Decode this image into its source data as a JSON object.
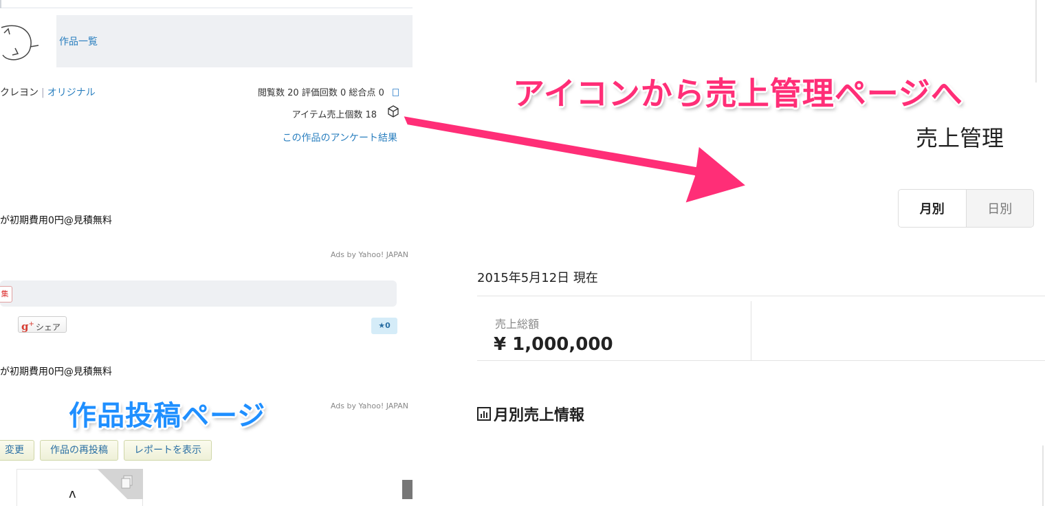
{
  "left": {
    "nav": {
      "works_list": "作品一覧"
    },
    "creator": {
      "name": "クレヨン",
      "category": "オリジナル"
    },
    "stats": {
      "views_label": "閲覧数",
      "views": "20",
      "ratings_label": "評価回数",
      "ratings": "0",
      "score_label": "総合点",
      "score": "0",
      "item_sales": "アイテム売上個数  18"
    },
    "survey_link": "この作品のアンケート結果",
    "ad1": {
      "text": "が初期費用0円@見積無料",
      "credit": "Ads by Yahoo! JAPAN"
    },
    "share": {
      "tag": "集",
      "gplus_label": "シェア",
      "star_count": "★0"
    },
    "ad2": {
      "text": "が初期費用0円@見積無料",
      "credit": "Ads by Yahoo! JAPAN"
    },
    "buttons": [
      "変更",
      "作品の再投稿",
      "レポートを表示"
    ],
    "pen_glyph": "ʌ"
  },
  "right": {
    "title": "売上管理",
    "segments": [
      {
        "label": "月別",
        "active": true
      },
      {
        "label": "日別",
        "active": false
      }
    ],
    "as_of": "2015年5月12日 現在",
    "total": {
      "label": "売上総額",
      "value": "¥ 1,000,000"
    },
    "monthly_heading": "月別売上情報"
  },
  "overlays": {
    "left_caption": "作品投稿ページ",
    "right_caption": "アイコンから売上管理ページへ"
  },
  "colors": {
    "link_blue": "#2a7fbf",
    "caption_blue": "#1f8fff",
    "caption_pink": "#ff2e77",
    "arrow_pink": "#ff2e77"
  },
  "icons": [
    "avatar-doodle-icon",
    "memo-icon",
    "box-icon",
    "google-plus-icon",
    "star-icon",
    "copy-icon",
    "bar-chart-icon",
    "arrow-icon"
  ]
}
